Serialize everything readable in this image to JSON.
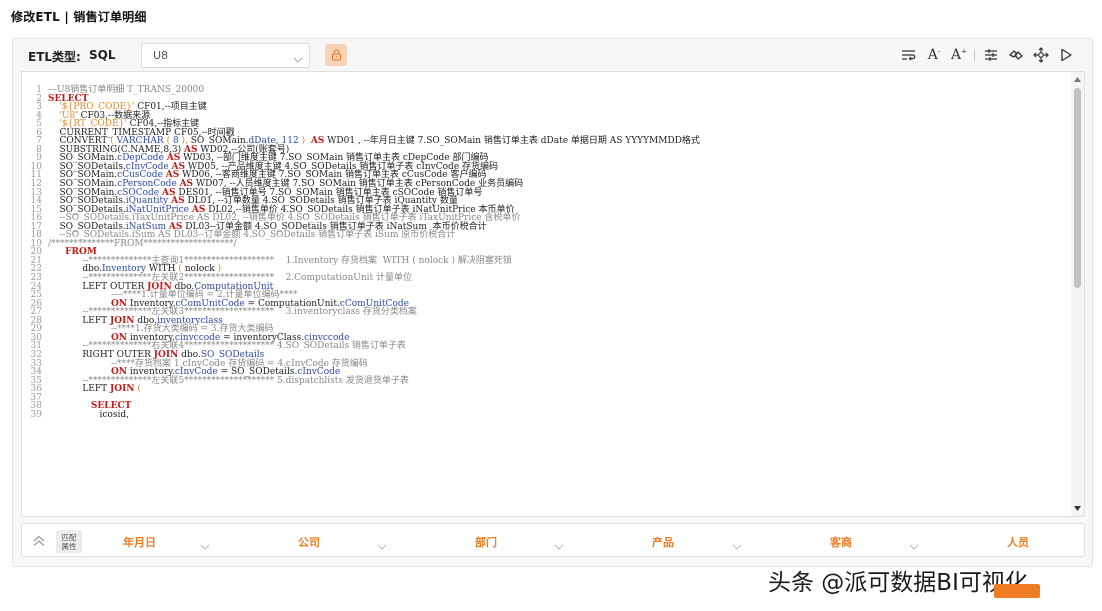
{
  "page": {
    "title": "修改ETL | 销售订单明细"
  },
  "toolbar": {
    "etl_type_label": "ETL类型:",
    "etl_type_value": "SQL",
    "db_select_value": "U8",
    "icons": [
      "lock-icon",
      "wrap-lines-icon",
      "font-decrease-icon",
      "font-increase-icon",
      "format-icon",
      "link-icon",
      "move-icon",
      "run-icon"
    ],
    "lock_color": "#f9d3b8",
    "accent": "#f07d24"
  },
  "editor": {
    "lines": [
      {
        "n": "1",
        "t": [
          [
            "c",
            "—U8销售订单明细 T_TRANS_20000"
          ]
        ]
      },
      {
        "n": "2",
        "t": [
          [
            "k",
            "SELECT"
          ]
        ]
      },
      {
        "n": "3",
        "t": [
          [
            "b",
            "    "
          ],
          [
            "s",
            "'${PRO_CODE}'"
          ],
          [
            "b",
            " CF01,--项目主键"
          ]
        ]
      },
      {
        "n": "4",
        "t": [
          [
            "b",
            "    "
          ],
          [
            "s",
            "'U8'"
          ],
          [
            "b",
            " CF03,--数据来源"
          ]
        ]
      },
      {
        "n": "5",
        "t": [
          [
            "b",
            "    "
          ],
          [
            "s",
            "'${RT_CODE}'"
          ],
          [
            "b",
            " CF04,--指标主键"
          ]
        ]
      },
      {
        "n": "6",
        "t": [
          [
            "b",
            "    CURRENT_TIMESTAMP CF05,--时间戳"
          ]
        ]
      },
      {
        "n": "7",
        "t": [
          [
            "b",
            "    CONVERT "
          ],
          [
            "s",
            "( "
          ],
          [
            "f",
            "VARCHAR"
          ],
          [
            "s",
            " ( "
          ],
          [
            "f",
            "8"
          ],
          [
            "s",
            " ),"
          ],
          [
            "b",
            " SO_SOMain."
          ],
          [
            "f",
            "dDate"
          ],
          [
            "b",
            ", "
          ],
          [
            "f",
            "112"
          ],
          [
            "s",
            " )"
          ],
          [
            "b",
            "  "
          ],
          [
            "k",
            "AS"
          ],
          [
            "b",
            " WD01 , --年月日主键 7.SO_SOMain 销售订单主表 dDate 单据日期 AS YYYYMMDD格式"
          ]
        ]
      },
      {
        "n": "8",
        "t": [
          [
            "b",
            "    SUBSTRING(C.NAME,8,3) "
          ],
          [
            "k",
            "AS"
          ],
          [
            "b",
            " WD02,--公司(账套号)"
          ]
        ]
      },
      {
        "n": "9",
        "t": [
          [
            "b",
            "    SO_SOMain."
          ],
          [
            "f",
            "cDepCode"
          ],
          [
            "b",
            " "
          ],
          [
            "k",
            "AS"
          ],
          [
            "b",
            " WD03, --部门维度主键 7.SO_SOMain 销售订单主表 cDepCode 部门编码"
          ]
        ]
      },
      {
        "n": "10",
        "t": [
          [
            "b",
            "    SO_SODetails."
          ],
          [
            "f",
            "cInvCode"
          ],
          [
            "b",
            " "
          ],
          [
            "k",
            "AS"
          ],
          [
            "b",
            " WD05, --产品维度主键 4.SO_SODetails 销售订单子表 cInvCode 存货编码"
          ]
        ]
      },
      {
        "n": "11",
        "t": [
          [
            "b",
            "    SO_SOMain."
          ],
          [
            "f",
            "cCusCode"
          ],
          [
            "b",
            " "
          ],
          [
            "k",
            "AS"
          ],
          [
            "b",
            " WD06, --客商维度主键 7.SO_SOMain 销售订单主表 cCusCode 客户编码"
          ]
        ]
      },
      {
        "n": "12",
        "t": [
          [
            "b",
            "    SO_SOMain."
          ],
          [
            "f",
            "cPersonCode"
          ],
          [
            "b",
            " "
          ],
          [
            "k",
            "AS"
          ],
          [
            "b",
            " WD07, --人员维度主键 7.SO_SOMain 销售订单主表 cPersonCode 业务员编码"
          ]
        ]
      },
      {
        "n": "13",
        "t": [
          [
            "b",
            "    SO_SOMain."
          ],
          [
            "f",
            "cSOCode"
          ],
          [
            "b",
            " "
          ],
          [
            "k",
            "AS"
          ],
          [
            "b",
            " DES01, --销售订单号 7.SO_SOMain 销售订单主表 cSOCode 销售订单号"
          ]
        ]
      },
      {
        "n": "14",
        "t": [
          [
            "b",
            "    SO_SODetails."
          ],
          [
            "f",
            "iQuantity"
          ],
          [
            "b",
            " "
          ],
          [
            "k",
            "AS"
          ],
          [
            "b",
            " DL01, --订单数量 4.SO_SODetails 销售订单子表 iQuantity 数量"
          ]
        ]
      },
      {
        "n": "15",
        "t": [
          [
            "b",
            "    SO_SODetails."
          ],
          [
            "f",
            "iNatUnitPrice"
          ],
          [
            "b",
            " "
          ],
          [
            "k",
            "AS"
          ],
          [
            "b",
            " DL02,--销售单价 4.SO_SODetails 销售订单子表 iNatUnitPrice 本币单价"
          ]
        ]
      },
      {
        "n": "16",
        "t": [
          [
            "c",
            "    --SO_SODetails.iTaxUnitPrice AS DL02, --销售单价 4.SO_SODetails 销售订单子表 iTaxUnitPrice 含税单价"
          ]
        ]
      },
      {
        "n": "17",
        "t": [
          [
            "b",
            "    SO_SODetails."
          ],
          [
            "f",
            "iNatSum"
          ],
          [
            "b",
            " "
          ],
          [
            "k",
            "AS"
          ],
          [
            "b",
            " DL03--订单金额 4.SO_SODetails 销售订单子表 iNatSum  本币价税合计"
          ]
        ]
      },
      {
        "n": "18",
        "t": [
          [
            "c",
            "    --SO_SODetails.iSum AS DL03--订单金额 4.SO_SODetails 销售订单子表 iSum 原币价税合计"
          ]
        ]
      },
      {
        "n": "19",
        "t": [
          [
            "c",
            "/**************FROM********************/"
          ]
        ]
      },
      {
        "n": "20",
        "t": [
          [
            "b",
            "      "
          ],
          [
            "k",
            "FROM"
          ]
        ]
      },
      {
        "n": "21",
        "t": [
          [
            "c",
            "            --**************主查询1********************    1.Inventory 存货档案  WITH ( nolock ) 解决阻塞死锁"
          ]
        ]
      },
      {
        "n": "22",
        "t": [
          [
            "b",
            "            dbo."
          ],
          [
            "f",
            "Inventory"
          ],
          [
            "b",
            " WITH "
          ],
          [
            "s",
            "( "
          ],
          [
            "b",
            "nolock "
          ],
          [
            "s",
            ")"
          ]
        ]
      },
      {
        "n": "23",
        "t": [
          [
            "c",
            "            --**************左关联2********************    2.ComputationUnit 计量单位"
          ]
        ]
      },
      {
        "n": "24",
        "t": [
          [
            "b",
            "            LEFT OUTER "
          ],
          [
            "k",
            "JOIN"
          ],
          [
            "b",
            " dbo."
          ],
          [
            "f",
            "ComputationUnit"
          ]
        ]
      },
      {
        "n": "25",
        "t": [
          [
            "c",
            "                      ----****1.计量单位编码 = 2.计量单位编码****"
          ]
        ]
      },
      {
        "n": "26",
        "t": [
          [
            "b",
            "                      "
          ],
          [
            "k",
            "ON"
          ],
          [
            "b",
            " Inventory."
          ],
          [
            "f",
            "cComUnitCode"
          ],
          [
            "b",
            " = ComputationUnit."
          ],
          [
            "f",
            "cComUnitCode"
          ]
        ]
      },
      {
        "n": "27",
        "t": [
          [
            "c",
            "            --**************左关联3********************    3.inventoryclass 存货分类档案"
          ]
        ]
      },
      {
        "n": "28",
        "t": [
          [
            "b",
            "            LEFT "
          ],
          [
            "k",
            "JOIN"
          ],
          [
            "b",
            " dbo."
          ],
          [
            "f",
            "inventoryclass"
          ]
        ]
      },
      {
        "n": "29",
        "t": [
          [
            "c",
            "                      --****1.存货大类编码 = 3.存货大类编码"
          ]
        ]
      },
      {
        "n": "30",
        "t": [
          [
            "b",
            "                      "
          ],
          [
            "k",
            "ON"
          ],
          [
            "b",
            " inventory."
          ],
          [
            "f",
            "cinvccode"
          ],
          [
            "b",
            " = inventoryClass."
          ],
          [
            "f",
            "cinvccode"
          ]
        ]
      },
      {
        "n": "31",
        "t": [
          [
            "c",
            "            --**************右关联4******************** 4.SO_SODetails 销售订单子表"
          ]
        ]
      },
      {
        "n": "32",
        "t": [
          [
            "b",
            "            RIGHT OUTER "
          ],
          [
            "k",
            "JOIN"
          ],
          [
            "b",
            " dbo."
          ],
          [
            "f",
            "SO_SODetails"
          ]
        ]
      },
      {
        "n": "33",
        "t": [
          [
            "c",
            "                      --****存货档案 1.cInvCode 存货编码 = 4.cInvCode 存货编码"
          ]
        ]
      },
      {
        "n": "34",
        "t": [
          [
            "b",
            "                      "
          ],
          [
            "k",
            "ON"
          ],
          [
            "b",
            " inventory."
          ],
          [
            "f",
            "cInvCode"
          ],
          [
            "b",
            " = SO_SODetails."
          ],
          [
            "f",
            "cInvCode"
          ]
        ]
      },
      {
        "n": "35",
        "t": [
          [
            "c",
            "            --**************左关联5******************** 5.dispatchlists 发货退货单子表"
          ]
        ]
      },
      {
        "n": "36",
        "t": [
          [
            "b",
            "            LEFT "
          ],
          [
            "k",
            "JOIN"
          ],
          [
            "b",
            " "
          ],
          [
            "s",
            "("
          ]
        ]
      },
      {
        "n": "37",
        "t": [
          [
            "b",
            ""
          ]
        ]
      },
      {
        "n": "38",
        "t": [
          [
            "b",
            "               "
          ],
          [
            "k",
            "SELECT"
          ]
        ]
      },
      {
        "n": "39",
        "t": [
          [
            "b",
            "                  icosid,"
          ]
        ]
      }
    ]
  },
  "attributes": {
    "match_label_1": "匹配",
    "match_label_2": "属性",
    "dimensions": [
      "年月日",
      "公司",
      "部门",
      "产品",
      "客商",
      "人员"
    ]
  },
  "watermark": {
    "text": "头条 @派可数据BI可视化"
  }
}
